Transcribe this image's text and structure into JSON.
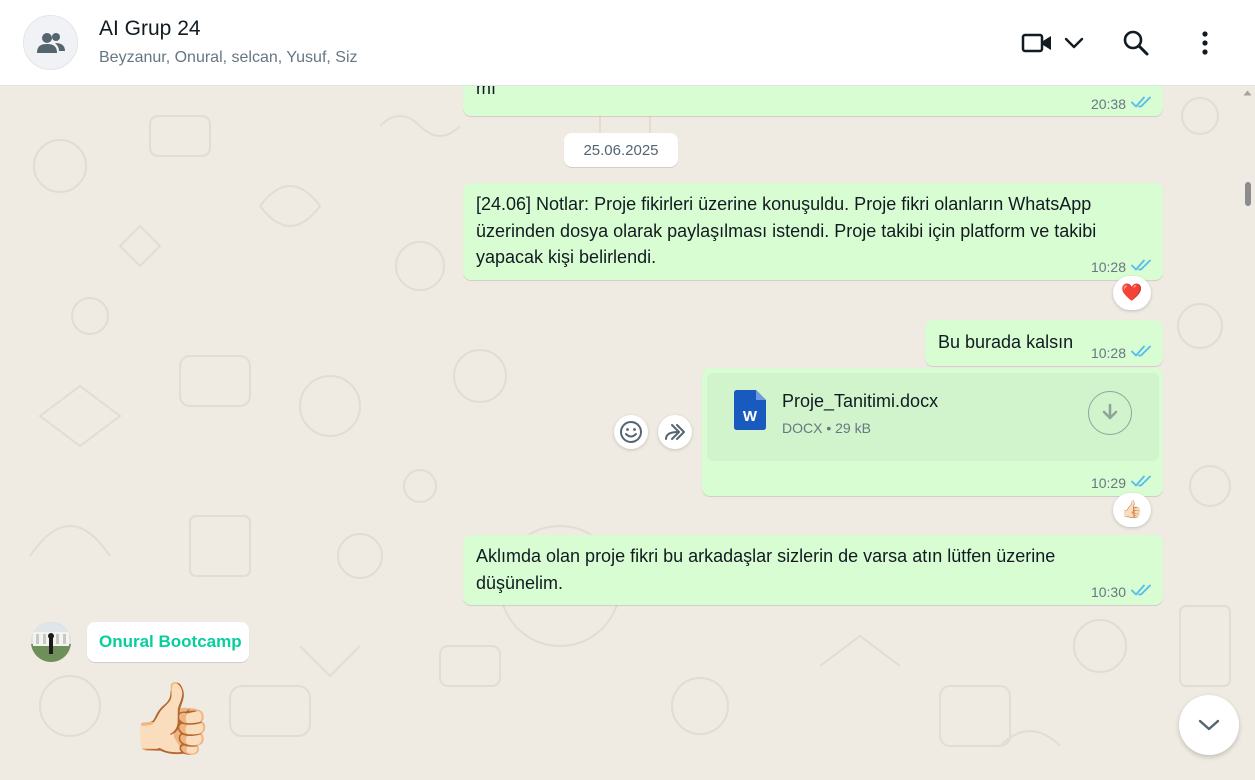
{
  "header": {
    "title": "AI Grup 24",
    "members": "Beyzanur, Onural, selcan, Yusuf, Siz",
    "icons": [
      "group-avatar-icon",
      "video-call-icon",
      "chevron-down-icon",
      "search-icon",
      "menu-icon"
    ]
  },
  "chat": {
    "messages": [
      {
        "text": "mı",
        "time": "20:38",
        "status": "read"
      },
      {
        "text": "[24.06] Notlar: Proje fikirleri üzerine konuşuldu. Proje fikri olanların WhatsApp üzerinden dosya olarak paylaşılması istendi. Proje takibi için platform ve takibi yapacak kişi belirlendi.",
        "time": "10:28",
        "status": "read",
        "reaction": "❤️"
      },
      {
        "text": "Bu burada kalsın",
        "time": "10:28",
        "status": "read"
      },
      {
        "document": {
          "name": "Proje_Tanitimi.docx",
          "type": "DOCX",
          "size": "29 kB",
          "icon_letter": "W"
        },
        "time": "10:29",
        "status": "read",
        "reaction": "👍🏻"
      },
      {
        "text": "Aklımda olan proje fikri bu arkadaşlar sizlerin de varsa atın lütfen üzerine düşünelim.",
        "time": "10:30",
        "status": "read"
      }
    ],
    "date_separator": "25.06.2025",
    "incoming": {
      "sender": "Onural Bootcamp",
      "sticker": "👍🏻"
    }
  },
  "colors": {
    "outgoing_bubble": "#d9fdd3",
    "read_ticks": "#53bdeb",
    "sender_name": "#06cf9c",
    "doc_icon": "#185abd",
    "background": "#efeae2"
  }
}
